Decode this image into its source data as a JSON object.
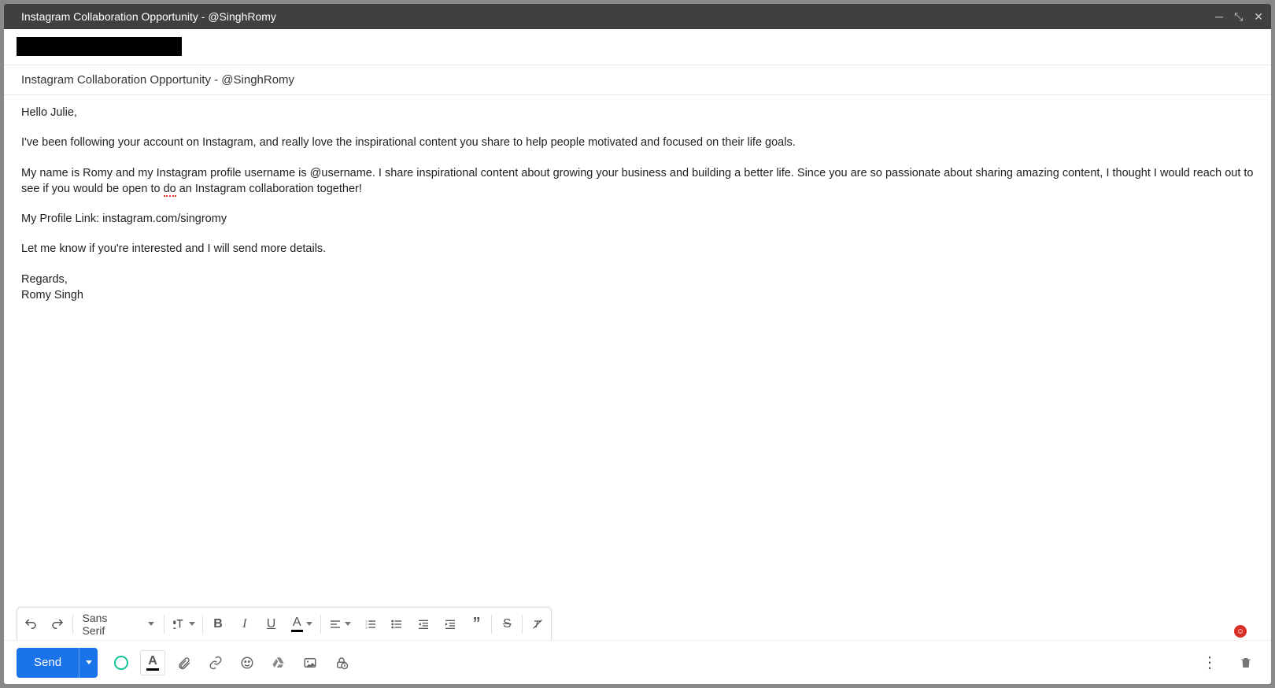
{
  "window": {
    "title": "Instagram Collaboration Opportunity - @SinghRomy"
  },
  "subject": "Instagram Collaboration Opportunity - @SinghRomy",
  "body": {
    "greeting": "Hello Julie,",
    "p1": "I've been following your account on Instagram, and really love the inspirational content you share to help people motivated and focused on their life goals.",
    "p2_before": "My name is Romy and my Instagram profile username is @username. I share inspirational content about growing your business and building a better life. Since you are so passionate about sharing amazing content, I thought I would reach out to see if you would be open to ",
    "p2_err": "do",
    "p2_after": " an Instagram collaboration together!",
    "p3": "My Profile Link: instagram.com/singromy",
    "p4": "Let me know if you're interested and I will send more details.",
    "signoff": "Regards,",
    "signature": "Romy Singh"
  },
  "format_bar": {
    "font": "Sans Serif"
  },
  "bottom": {
    "send": "Send"
  }
}
